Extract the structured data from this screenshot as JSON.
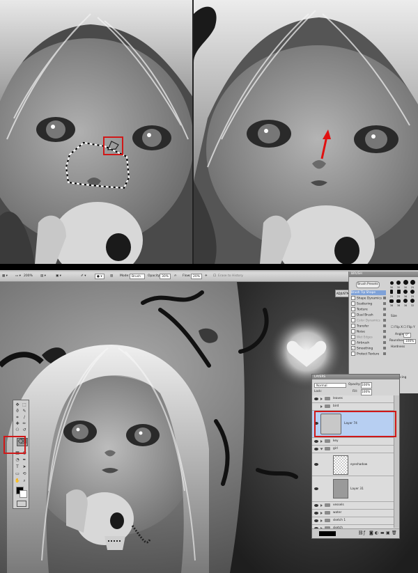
{
  "colors": {
    "highlight": "#d01818",
    "selected_layer": "#b7cff2",
    "panel_bg": "#d4d4d4"
  },
  "options_bar": {
    "zoom": "200%",
    "mode_label": "Mode:",
    "mode_value": "Brush",
    "opacity_label": "Opacity:",
    "opacity_value": "30%",
    "flow_label": "Flow:",
    "flow_value": "20%",
    "erase_history": "Erase to History"
  },
  "adjustments_tab": {
    "label": "ADJUSTM"
  },
  "brush_panel": {
    "title": "BRUSH",
    "presets_button": "Brush Presets",
    "options": [
      "Brush Tip Shape",
      "Shape Dynamics",
      "Scattering",
      "Texture",
      "Dual Brush",
      "Color Dynamics",
      "Transfer",
      "Noise",
      "Wet Edges",
      "Airbrush",
      "Smoothing",
      "Protect Texture"
    ],
    "tip_sizes": [
      "30",
      "30",
      "30",
      "25",
      "25",
      "25",
      "36",
      "25",
      "36",
      "36",
      "36",
      "32"
    ],
    "size_label": "Size",
    "flip_x": "Flip X",
    "flip_y": "Flip Y",
    "angle_label": "Angle:",
    "angle_value": "0°",
    "roundness_label": "Roundness:",
    "roundness_value": "100%",
    "hardness_label": "Hardness",
    "spacing_label": "Spacing"
  },
  "layers_panel": {
    "title": "LAYERS",
    "blend_mode": "Normal",
    "opacity_label": "Opacity:",
    "opacity_value": "100%",
    "lock_label": "Lock:",
    "fill_label": "Fill:",
    "fill_value": "100%",
    "layers": [
      {
        "name": "leaves",
        "type": "group"
      },
      {
        "name": "bird",
        "type": "group"
      },
      {
        "name": "Layer 74",
        "type": "layer",
        "selected": true
      },
      {
        "name": "key",
        "type": "group"
      },
      {
        "name": "girl",
        "type": "group"
      },
      {
        "name": "eyeshadow",
        "type": "layer"
      },
      {
        "name": "Layer 31",
        "type": "layer"
      },
      {
        "name": "vessels",
        "type": "group"
      },
      {
        "name": "water",
        "type": "group"
      },
      {
        "name": "sketch 1",
        "type": "group"
      },
      {
        "name": "sketch",
        "type": "group"
      }
    ]
  },
  "tools": [
    "move",
    "marquee",
    "lasso",
    "quick-select",
    "crop",
    "eyedropper",
    "healing",
    "brush",
    "clone",
    "history",
    "eraser",
    "gradient",
    "dodge",
    "pen",
    "type",
    "path-select",
    "shape",
    "hand",
    "zoom"
  ]
}
